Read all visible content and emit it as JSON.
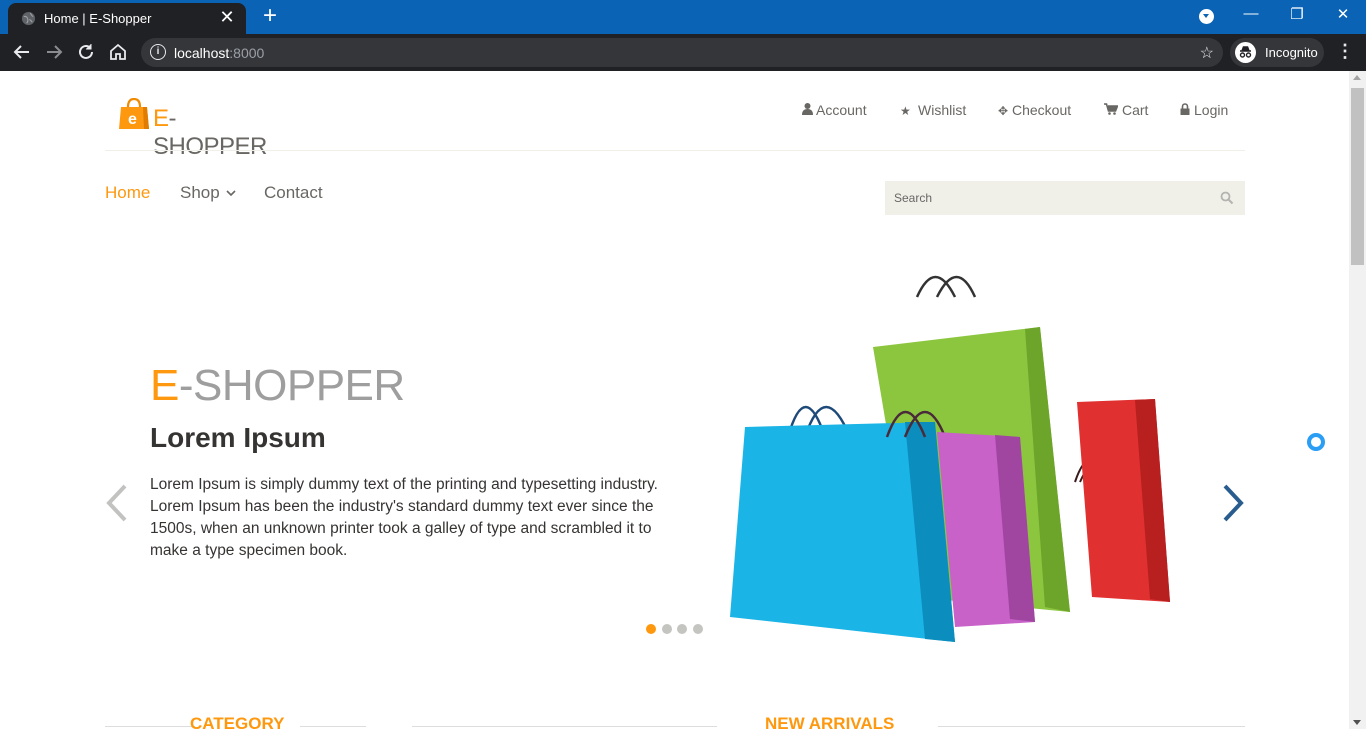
{
  "browser": {
    "tab_title": "Home | E-Shopper",
    "url_host": "localhost",
    "url_port": ":8000",
    "profile_label": "Incognito"
  },
  "site": {
    "brand_prefix": "E",
    "brand_rest": "-SHOPPER",
    "top_nav": [
      {
        "label": "Account",
        "icon": "user-icon"
      },
      {
        "label": "Wishlist",
        "icon": "star-icon"
      },
      {
        "label": "Checkout",
        "icon": "crosshairs-icon"
      },
      {
        "label": "Cart",
        "icon": "cart-icon"
      },
      {
        "label": "Login",
        "icon": "lock-icon"
      }
    ],
    "main_nav": {
      "home": "Home",
      "shop": "Shop",
      "contact": "Contact"
    },
    "search_placeholder": "Search"
  },
  "slider": {
    "brand_prefix": "E",
    "brand_rest": "-SHOPPER",
    "title": "Lorem Ipsum",
    "text": "Lorem Ipsum is simply dummy text of the printing and typesetting industry. Lorem Ipsum has been the industry's standard dummy text ever since the 1500s, when an unknown printer took a galley of type and scrambled it to make a type specimen book.",
    "slide_count": 4,
    "active_slide": 1
  },
  "sections": {
    "category": "CATEGORY",
    "new_arrivals": "NEW ARRIVALS"
  },
  "colors": {
    "accent": "#fe980f",
    "tabbar": "#0a63b4",
    "chrome_dark": "#202124"
  }
}
